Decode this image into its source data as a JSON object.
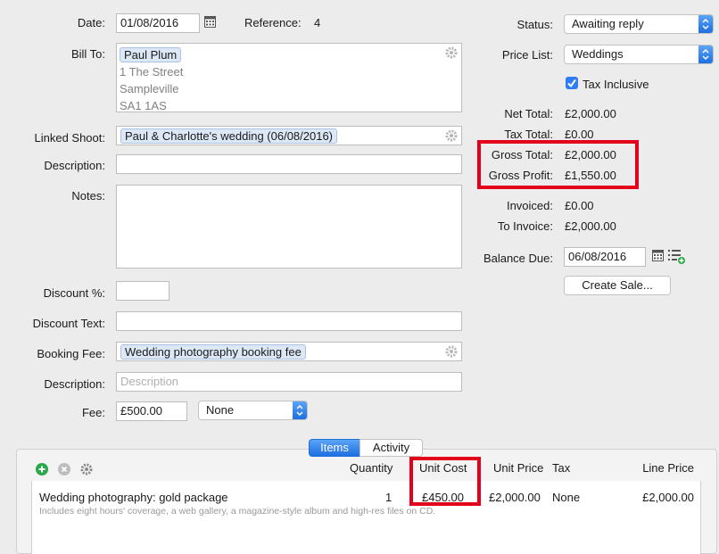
{
  "header": {
    "date_label": "Date:",
    "date_value": "01/08/2016",
    "reference_label": "Reference:",
    "reference_value": "4"
  },
  "bill_to": {
    "label": "Bill To:",
    "name": "Paul Plum",
    "address": [
      "1 The Street",
      "Sampleville",
      "SA1 1AS"
    ]
  },
  "linked_shoot": {
    "label": "Linked Shoot:",
    "value": "Paul & Charlotte's wedding (06/08/2016)"
  },
  "description": {
    "label": "Description:",
    "value": ""
  },
  "notes": {
    "label": "Notes:",
    "value": ""
  },
  "discount_pct": {
    "label": "Discount %:",
    "value": ""
  },
  "discount_text": {
    "label": "Discount Text:",
    "value": ""
  },
  "booking_fee": {
    "label": "Booking Fee:",
    "value": "Wedding photography booking fee"
  },
  "fee_description": {
    "label": "Description:",
    "placeholder": "Description"
  },
  "fee": {
    "label": "Fee:",
    "value": "£500.00",
    "tax_option": "None"
  },
  "status": {
    "label": "Status:",
    "value": "Awaiting reply"
  },
  "price_list": {
    "label": "Price List:",
    "value": "Weddings"
  },
  "tax_inclusive": {
    "label": "Tax Inclusive",
    "checked": true
  },
  "totals": {
    "net_total_label": "Net Total:",
    "net_total": "£2,000.00",
    "tax_total_label": "Tax Total:",
    "tax_total": "£0.00",
    "gross_total_label": "Gross Total:",
    "gross_total": "£2,000.00",
    "gross_profit_label": "Gross Profit:",
    "gross_profit": "£1,550.00",
    "invoiced_label": "Invoiced:",
    "invoiced": "£0.00",
    "to_invoice_label": "To Invoice:",
    "to_invoice": "£2,000.00"
  },
  "balance_due": {
    "label": "Balance Due:",
    "value": "06/08/2016"
  },
  "create_sale_label": "Create Sale...",
  "tabs": [
    {
      "label": "Items",
      "active": true
    },
    {
      "label": "Activity",
      "active": false
    }
  ],
  "items_table": {
    "columns": [
      "Quantity",
      "Unit Cost",
      "Unit Price",
      "Tax",
      "Line Price"
    ],
    "rows": [
      {
        "name": "Wedding photography: gold package",
        "details": "Includes eight hours' coverage, a web gallery, a magazine-style album and high-res files on CD.",
        "quantity": "1",
        "unit_cost": "£450.00",
        "unit_price": "£2,000.00",
        "tax": "None",
        "line_price": "£2,000.00"
      }
    ]
  },
  "colors": {
    "highlight_red": "#e3001b",
    "accent_blue": "#1e6fe0",
    "add_green": "#2aa84a"
  }
}
